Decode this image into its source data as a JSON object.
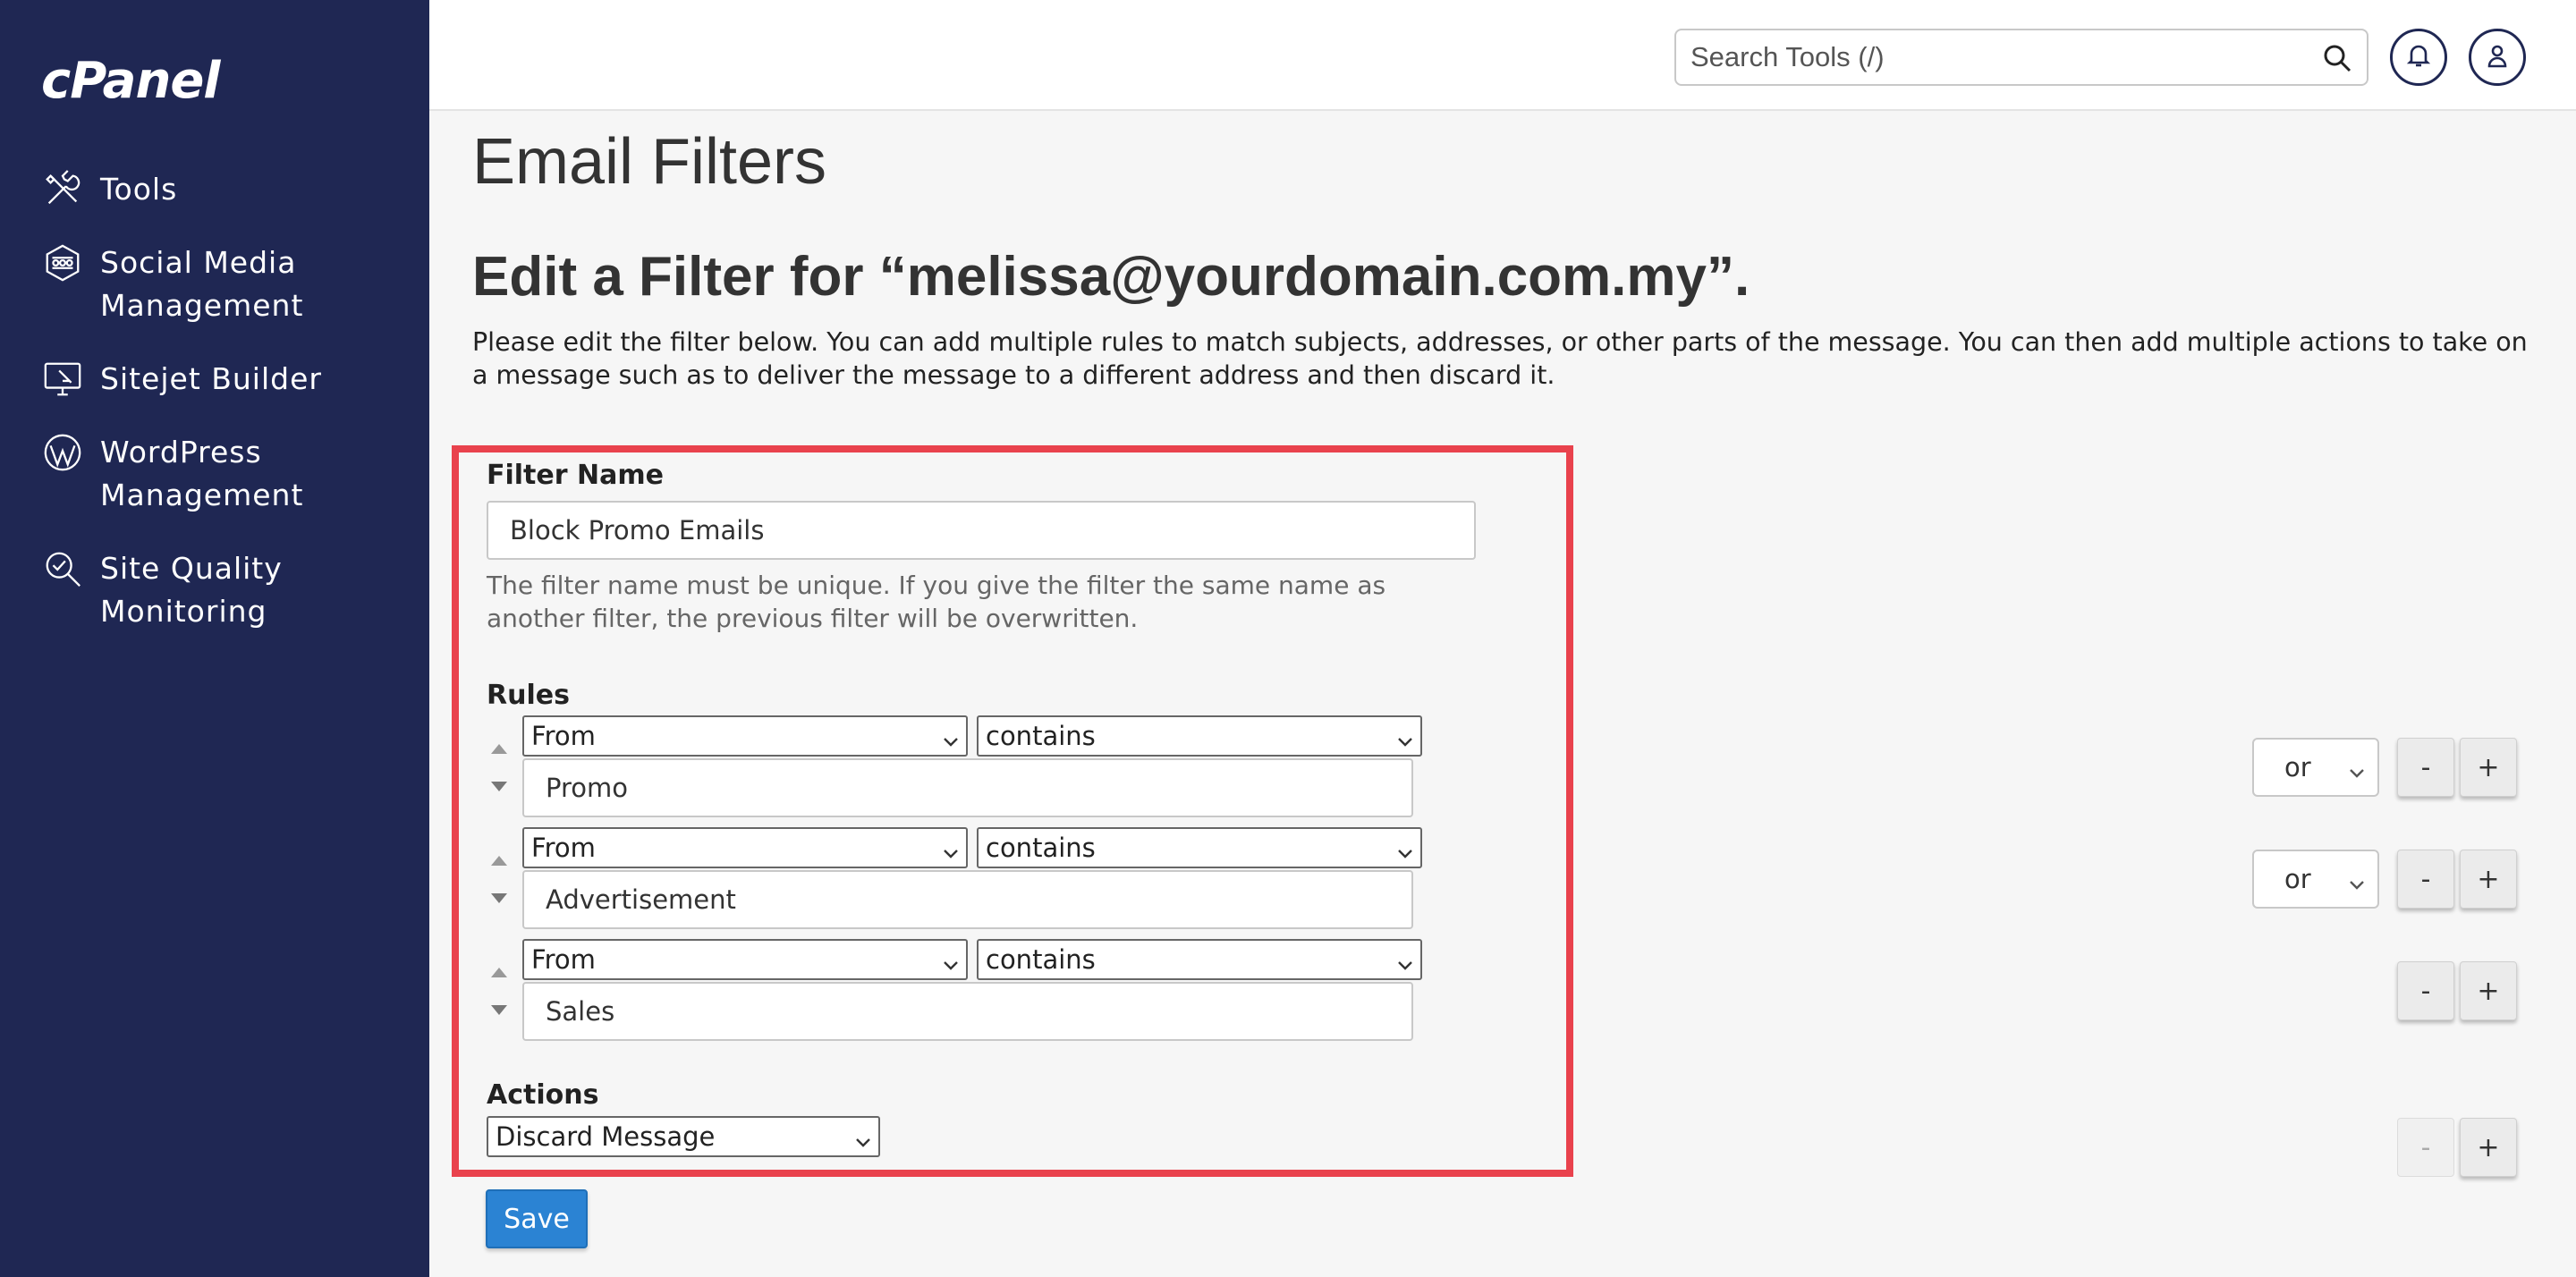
{
  "brand": {
    "logo": "cPanel"
  },
  "sidebar": {
    "items": [
      {
        "label": "Tools",
        "icon": "tools-icon"
      },
      {
        "label": "Social Media\nManagement",
        "icon": "social-media-icon"
      },
      {
        "label": "Sitejet Builder",
        "icon": "sitejet-icon"
      },
      {
        "label": "WordPress\nManagement",
        "icon": "wordpress-icon"
      },
      {
        "label": "Site Quality\nMonitoring",
        "icon": "site-quality-icon"
      }
    ]
  },
  "header": {
    "search_placeholder": "Search Tools (/)",
    "icons": [
      "search-icon",
      "bell-icon",
      "user-icon"
    ]
  },
  "page": {
    "title": "Email Filters",
    "section_title": "Edit a Filter for “melissa@yourdomain.com.my”.",
    "description": "Please edit the filter below. You can add multiple rules to match subjects, addresses, or other parts of the message. You can then add multiple actions to take on a message such as to deliver the message to a different address and then discard it."
  },
  "form": {
    "filter_name_label": "Filter Name",
    "filter_name_value": "Block Promo Emails",
    "filter_name_help": "The filter name must be unique. If you give the filter the same name as another filter, the previous filter will be overwritten.",
    "rules_label": "Rules",
    "rules": [
      {
        "field": "From",
        "operator": "contains",
        "value": "Promo",
        "conjunction": "or"
      },
      {
        "field": "From",
        "operator": "contains",
        "value": "Advertisement",
        "conjunction": "or"
      },
      {
        "field": "From",
        "operator": "contains",
        "value": "Sales",
        "conjunction": ""
      }
    ],
    "actions_label": "Actions",
    "action_value": "Discard Message",
    "minus_label": "-",
    "plus_label": "+",
    "save_label": "Save"
  },
  "colors": {
    "sidebar_bg": "#1f2753",
    "highlight_border": "#e9424d",
    "save_button": "#2b83d3"
  }
}
